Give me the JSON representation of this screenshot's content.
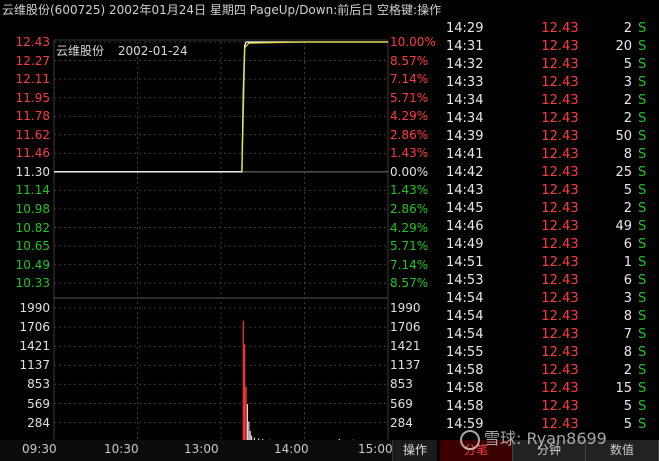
{
  "window": {
    "title": "云维股份(600725) 2002年01月24日 星期四 PageUp/Down:前后日 空格键:操作"
  },
  "chart_header": {
    "stock_name": "云维股份",
    "date": "2002-01-24"
  },
  "colors": {
    "background": "#000000",
    "up": "#ff3b3b",
    "down": "#1ec81e",
    "neutral": "#e0e0e0",
    "price_line": "#ffffff",
    "avg_line": "#e8e040",
    "grid": "#3a3a3a"
  },
  "chart_data": [
    {
      "type": "line",
      "title": "",
      "x_ticks": [
        "09:30",
        "10:30",
        "13:00",
        "14:00",
        "15:00"
      ],
      "y_ticks_left": [
        "12.43",
        "12.27",
        "12.11",
        "11.95",
        "11.78",
        "11.62",
        "11.46",
        "11.30",
        "11.14",
        "10.98",
        "10.82",
        "10.65",
        "10.49",
        "10.33"
      ],
      "y_ticks_right": [
        "10.00%",
        "8.57%",
        "7.14%",
        "5.71%",
        "4.29%",
        "2.86%",
        "1.43%",
        "0.00%",
        "1.43%",
        "2.86%",
        "4.29%",
        "5.71%",
        "7.14%",
        "8.57%"
      ],
      "ylim": [
        10.17,
        12.43
      ],
      "prev_close": 11.3,
      "series": [
        {
          "values": [
            [
              "09:30",
              11.3
            ],
            [
              "10:00",
              11.3
            ],
            [
              "10:30",
              11.3
            ],
            [
              "11:00",
              11.3
            ],
            [
              "11:30",
              11.3
            ],
            [
              "13:00",
              11.3
            ],
            [
              "13:15",
              11.3
            ],
            [
              "13:16",
              12.0
            ],
            [
              "13:17",
              12.4
            ],
            [
              "13:18",
              12.43
            ],
            [
              "14:00",
              12.43
            ],
            [
              "14:30",
              12.43
            ],
            [
              "15:00",
              12.43
            ]
          ]
        },
        {
          "values": [
            [
              "13:15",
              11.3
            ],
            [
              "13:17",
              12.38
            ],
            [
              "13:20",
              12.42
            ],
            [
              "14:00",
              12.43
            ],
            [
              "15:00",
              12.43
            ]
          ]
        }
      ]
    },
    {
      "type": "bar",
      "title": "",
      "y_ticks": [
        "1990",
        "1706",
        "1421",
        "1137",
        "853",
        "569",
        "284"
      ],
      "ylim": [
        0,
        1990
      ],
      "bars": [
        [
          "13:16",
          1800
        ],
        [
          "13:17",
          1450
        ],
        [
          "13:18",
          820
        ],
        [
          "13:19",
          560
        ],
        [
          "13:20",
          300
        ],
        [
          "13:21",
          160
        ],
        [
          "13:22",
          90
        ],
        [
          "13:24",
          60
        ],
        [
          "13:27",
          50
        ],
        [
          "13:30",
          40
        ],
        [
          "13:35",
          30
        ],
        [
          "13:40",
          25
        ],
        [
          "13:45",
          20
        ],
        [
          "13:50",
          18
        ],
        [
          "13:55",
          15
        ],
        [
          "14:00",
          12
        ],
        [
          "14:05",
          10
        ],
        [
          "14:10",
          20
        ],
        [
          "14:15",
          8
        ],
        [
          "14:20",
          10
        ],
        [
          "14:25",
          40
        ],
        [
          "14:30",
          12
        ],
        [
          "14:35",
          30
        ],
        [
          "14:40",
          25
        ],
        [
          "14:45",
          15
        ],
        [
          "14:50",
          10
        ],
        [
          "14:55",
          22
        ],
        [
          "15:00",
          18
        ]
      ]
    }
  ],
  "trades": [
    {
      "time": "14:29",
      "price": "12.43",
      "volume": "2",
      "flag": "S"
    },
    {
      "time": "14:31",
      "price": "12.43",
      "volume": "20",
      "flag": "S"
    },
    {
      "time": "14:32",
      "price": "12.43",
      "volume": "5",
      "flag": "S"
    },
    {
      "time": "14:33",
      "price": "12.43",
      "volume": "3",
      "flag": "S"
    },
    {
      "time": "14:34",
      "price": "12.43",
      "volume": "2",
      "flag": "S"
    },
    {
      "time": "14:34",
      "price": "12.43",
      "volume": "2",
      "flag": "S"
    },
    {
      "time": "14:39",
      "price": "12.43",
      "volume": "50",
      "flag": "S"
    },
    {
      "time": "14:41",
      "price": "12.43",
      "volume": "8",
      "flag": "S"
    },
    {
      "time": "14:42",
      "price": "12.43",
      "volume": "25",
      "flag": "S"
    },
    {
      "time": "14:43",
      "price": "12.43",
      "volume": "5",
      "flag": "S"
    },
    {
      "time": "14:45",
      "price": "12.43",
      "volume": "2",
      "flag": "S"
    },
    {
      "time": "14:46",
      "price": "12.43",
      "volume": "49",
      "flag": "S"
    },
    {
      "time": "14:49",
      "price": "12.43",
      "volume": "6",
      "flag": "S"
    },
    {
      "time": "14:51",
      "price": "12.43",
      "volume": "1",
      "flag": "S"
    },
    {
      "time": "14:53",
      "price": "12.43",
      "volume": "6",
      "flag": "S"
    },
    {
      "time": "14:54",
      "price": "12.43",
      "volume": "3",
      "flag": "S"
    },
    {
      "time": "14:54",
      "price": "12.43",
      "volume": "8",
      "flag": "S"
    },
    {
      "time": "14:54",
      "price": "12.43",
      "volume": "7",
      "flag": "S"
    },
    {
      "time": "14:55",
      "price": "12.43",
      "volume": "8",
      "flag": "S"
    },
    {
      "time": "14:58",
      "price": "12.43",
      "volume": "2",
      "flag": "S"
    },
    {
      "time": "14:58",
      "price": "12.43",
      "volume": "15",
      "flag": "S"
    },
    {
      "time": "14:58",
      "price": "12.43",
      "volume": "5",
      "flag": "S"
    },
    {
      "time": "14:59",
      "price": "12.43",
      "volume": "5",
      "flag": "S"
    }
  ],
  "bottom": {
    "op_tab": "操作",
    "tabs": [
      "分笔",
      "分钟",
      "数值"
    ]
  },
  "watermark": {
    "text": "雪球: Ryan8699"
  }
}
